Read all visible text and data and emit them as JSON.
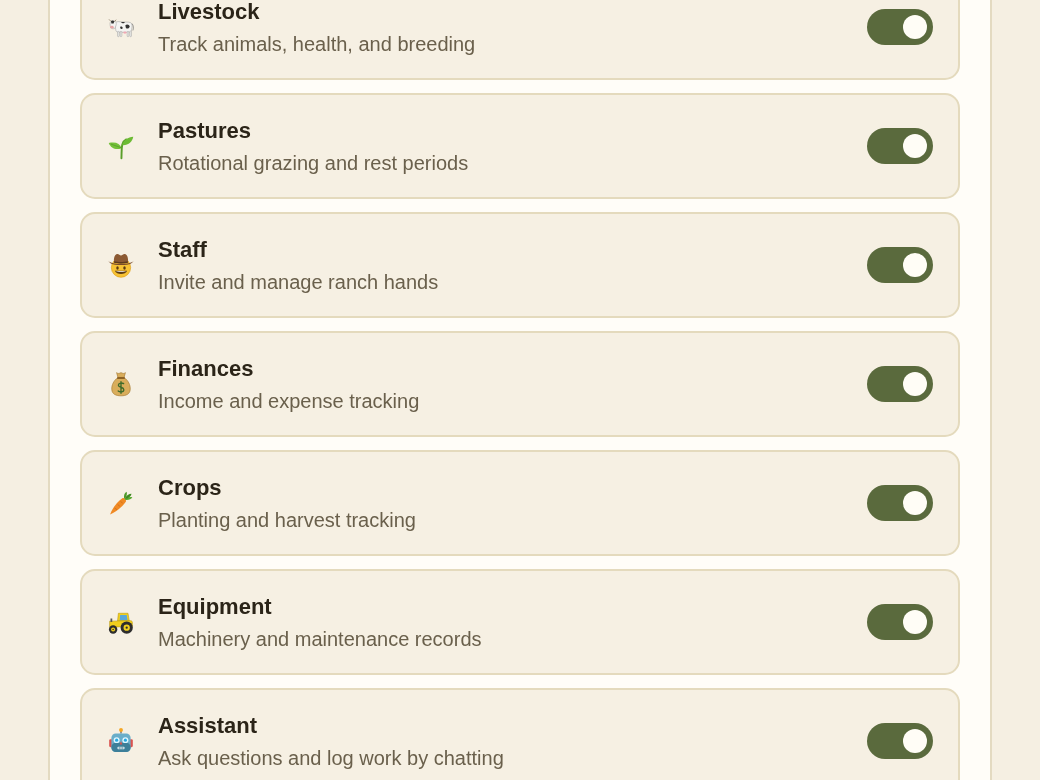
{
  "modules": [
    {
      "title": "Livestock",
      "description": "Track animals, health, and breeding",
      "on": true
    },
    {
      "title": "Pastures",
      "description": "Rotational grazing and rest periods",
      "on": true
    },
    {
      "title": "Staff",
      "description": "Invite and manage ranch hands",
      "on": true
    },
    {
      "title": "Finances",
      "description": "Income and expense tracking",
      "on": true
    },
    {
      "title": "Crops",
      "description": "Planting and harvest tracking",
      "on": true
    },
    {
      "title": "Equipment",
      "description": "Machinery and maintenance records",
      "on": true
    },
    {
      "title": "Assistant",
      "description": "Ask questions and log work by chatting",
      "on": true
    }
  ]
}
